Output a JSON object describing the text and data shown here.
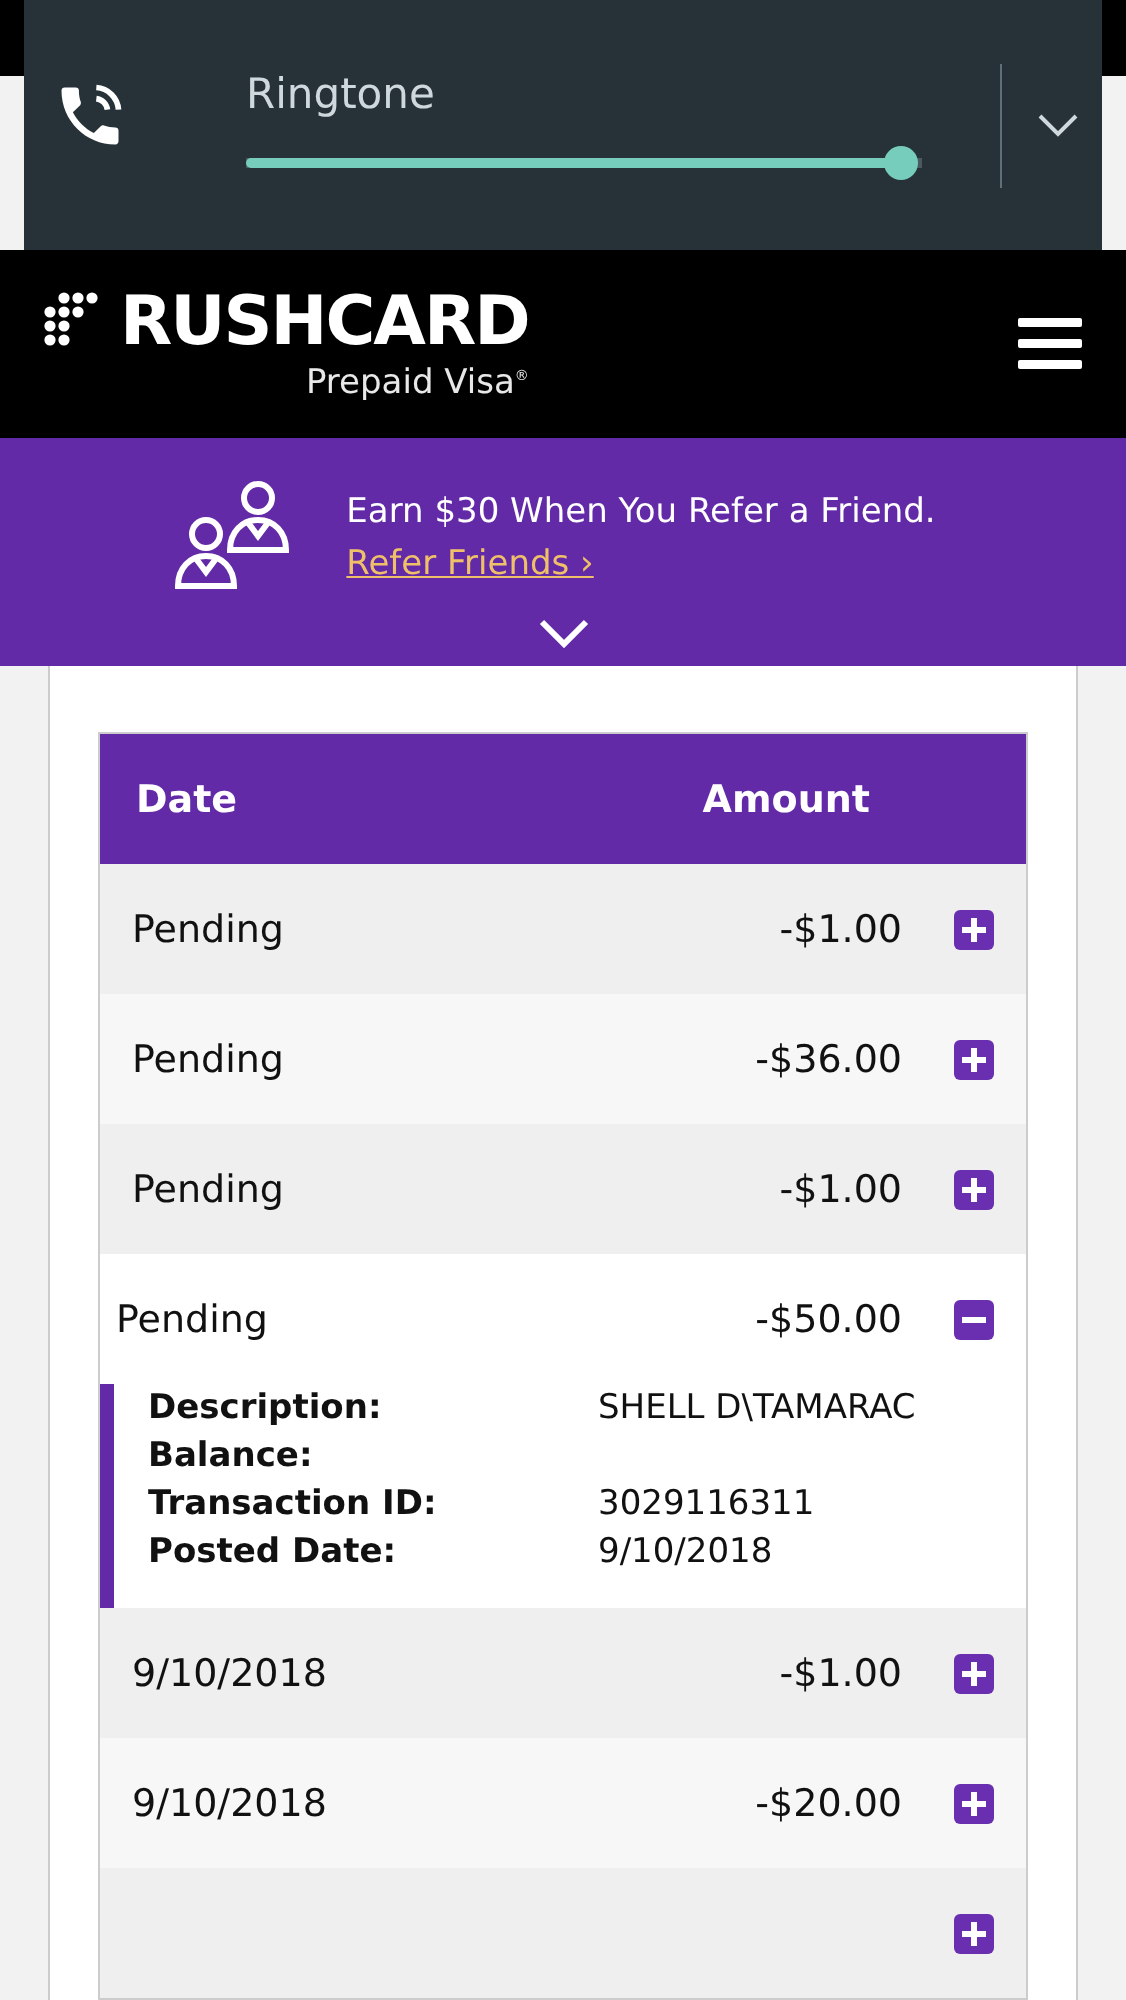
{
  "volume_panel": {
    "label": "Ringtone",
    "level": 0.97
  },
  "header": {
    "brand": "RUSHCARD",
    "tagline": "Prepaid Visa",
    "registered": "®"
  },
  "banner": {
    "text": "Earn $30 When You Refer a Friend.",
    "link": "Refer Friends ›"
  },
  "table": {
    "columns": [
      "Date",
      "Amount"
    ],
    "rows": [
      {
        "date": "Pending",
        "amount": "-$1.00",
        "expanded": false
      },
      {
        "date": "Pending",
        "amount": "-$36.00",
        "expanded": false
      },
      {
        "date": "Pending",
        "amount": "-$1.00",
        "expanded": false
      },
      {
        "date": "Pending",
        "amount": "-$50.00",
        "expanded": true,
        "details": [
          {
            "label": "Description:",
            "value": "SHELL D\\TAMARAC"
          },
          {
            "label": "Balance:"
          },
          {
            "label": "Transaction ID:",
            "value": "3029116311"
          },
          {
            "label": "Posted Date:",
            "value": "9/10/2018"
          }
        ]
      },
      {
        "date": "9/10/2018",
        "amount": "-$1.00",
        "expanded": false
      },
      {
        "date": "9/10/2018",
        "amount": "-$20.00",
        "expanded": false
      },
      {
        "expanded": false
      }
    ]
  }
}
